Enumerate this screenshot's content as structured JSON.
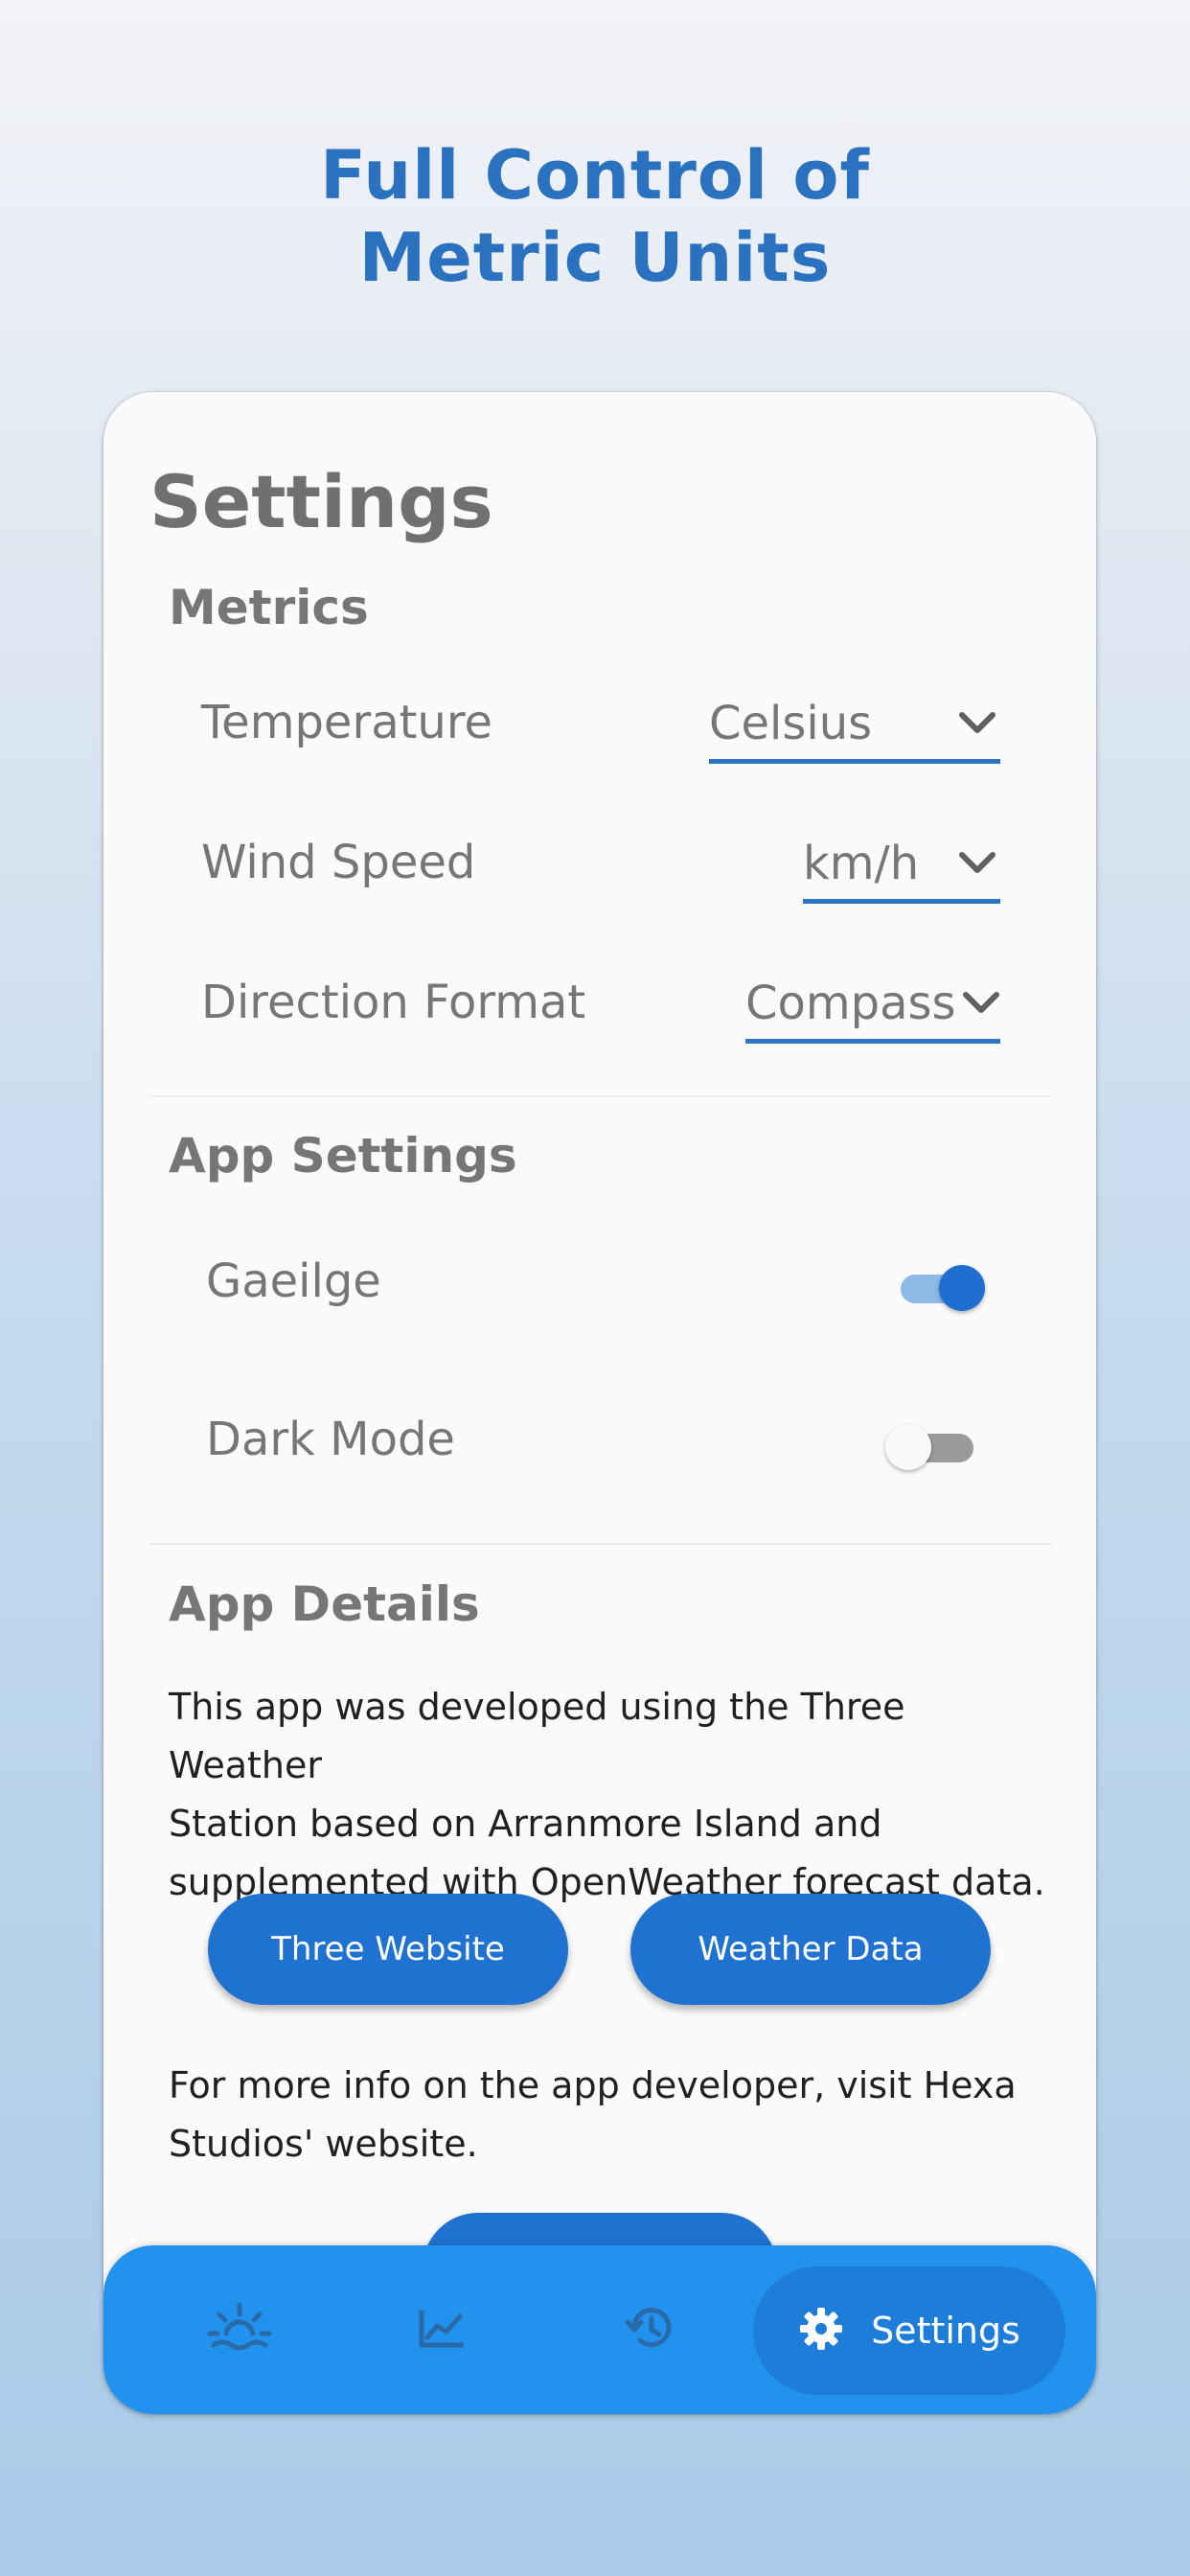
{
  "promo": {
    "title_line1": "Full Control of",
    "title_line2": "Metric Units"
  },
  "settings": {
    "heading": "Settings",
    "metrics": {
      "title": "Metrics",
      "rows": [
        {
          "label": "Temperature",
          "value": "Celsius"
        },
        {
          "label": "Wind Speed",
          "value": "km/h"
        },
        {
          "label": "Direction Format",
          "value": "Compass"
        }
      ]
    },
    "app_settings": {
      "title": "App Settings",
      "toggles": [
        {
          "label": "Gaeilge",
          "state": "on"
        },
        {
          "label": "Dark Mode",
          "state": "off"
        }
      ]
    },
    "app_details": {
      "title": "App Details",
      "description_line1": "This app was developed using the Three Weather",
      "description_line2": "Station based on Arranmore Island and",
      "description_line3": "supplemented with OpenWeather forecast data.",
      "buttons": [
        "Three Website",
        "Weather Data"
      ],
      "more_info_line1": "For more info on the app developer, visit Hexa",
      "more_info_line2": "Studios' website."
    }
  },
  "nav": {
    "items": [
      {
        "icon": "sunrise-icon"
      },
      {
        "icon": "chart-icon"
      },
      {
        "icon": "history-icon"
      }
    ],
    "active": {
      "icon": "gear-icon",
      "label": "Settings"
    }
  },
  "colors": {
    "accent": "#1f72cf",
    "nav_bar": "#2193ee",
    "title_blue": "#2a71bf",
    "toggle_on": "#1f6fd3"
  }
}
